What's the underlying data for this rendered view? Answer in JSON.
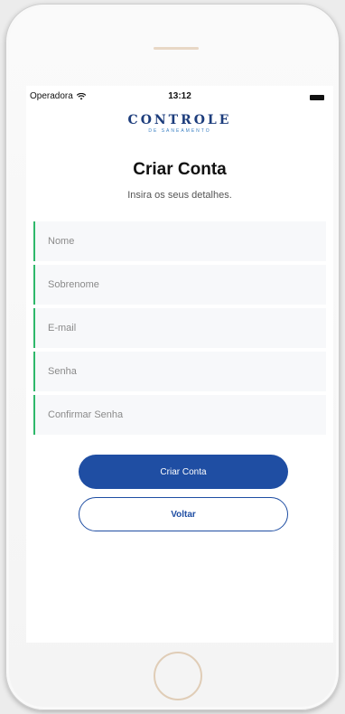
{
  "status_bar": {
    "carrier": "Operadora",
    "time": "13:12"
  },
  "logo": {
    "main": "CONTROLE",
    "sub": "DE SANEAMENTO"
  },
  "header": {
    "title": "Criar Conta",
    "subtitle": "Insira os seus detalhes."
  },
  "form": {
    "fields": [
      {
        "placeholder": "Nome"
      },
      {
        "placeholder": "Sobrenome"
      },
      {
        "placeholder": "E-mail"
      },
      {
        "placeholder": "Senha"
      },
      {
        "placeholder": "Confirmar Senha"
      }
    ]
  },
  "buttons": {
    "create_label": "Criar Conta",
    "back_label": "Voltar"
  },
  "colors": {
    "primary": "#1f4ea3",
    "field_accent": "#2fb86a"
  }
}
